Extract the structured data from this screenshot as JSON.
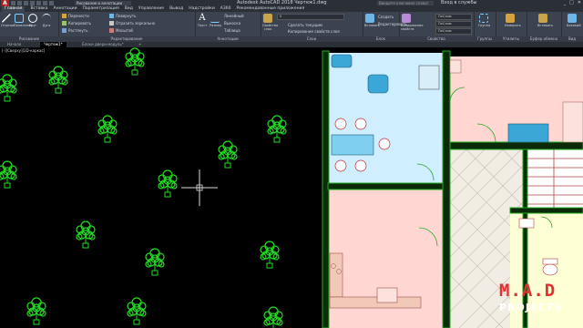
{
  "titlebar": {
    "logo": "A",
    "workspace": "Рисование и аннотации",
    "title": "Autodesk AutoCAD 2018  Чертеж1.dwg",
    "search": "Введите ключевое слово/фразу",
    "user": "Вход в службы",
    "window_buttons": [
      "_",
      "□",
      "✕"
    ]
  },
  "menubar": {
    "tabs": [
      "Главная",
      "Вставка",
      "Аннотации",
      "Параметризация",
      "Вид",
      "Управление",
      "Вывод",
      "Надстройки",
      "A360",
      "Рекомендованные приложения"
    ]
  },
  "ribbon": {
    "draw": {
      "title": "Рисование",
      "tools": [
        "Отрезок",
        "Полилиния",
        "Круг",
        "Дуга"
      ]
    },
    "modify": {
      "title": "Редактирование",
      "rows": [
        [
          "Перенести",
          "Повернуть"
        ],
        [
          "Копировать",
          "Отразить зеркально"
        ],
        [
          "Растянуть",
          "Масштаб"
        ]
      ]
    },
    "annotation": {
      "title": "Аннотации",
      "tools": [
        "Текст",
        "Размер"
      ],
      "rows": [
        "Линейный",
        "Выноска",
        "Таблица"
      ]
    },
    "layers": {
      "title": "Слои",
      "big": "Свойства слоя",
      "current_layer": "0",
      "rows": [
        "Сделать текущим",
        "Копирование свойств слоя"
      ]
    },
    "block": {
      "title": "Блок",
      "tools": [
        "Вставить",
        "Создать",
        "Редактировать"
      ]
    },
    "properties": {
      "title": "Свойства",
      "big": "Копирование свойств",
      "combos": [
        "ПоСлою",
        "ПоСлою",
        "ПоСлою"
      ]
    },
    "groups": {
      "title": "Группы",
      "big": "Группа"
    },
    "utilities": {
      "title": "Утилиты",
      "big": "Измерить"
    },
    "clipboard": {
      "title": "Буфер обмена",
      "big": "Вставить"
    },
    "view": {
      "title": "Вид",
      "big": "Базовый"
    }
  },
  "doctabs": {
    "items": [
      "Начало",
      "Чертеж1*",
      "Блоки двери-модуль*"
    ],
    "add": "+"
  },
  "canvas": {
    "viewport_label": "[-][Сверху][2D-каркас]"
  },
  "watermark": {
    "line1": "M.A.D",
    "line2": "PROJECTS"
  },
  "colors": {
    "plant": "#22dd22",
    "wall": "#22aa22",
    "room_blue": "#cfeeff",
    "room_pink": "#ffd6d2",
    "room_yellow": "#ffffd6",
    "furniture_blue": "#3aa7d6",
    "watermark_red": "#e03030"
  }
}
